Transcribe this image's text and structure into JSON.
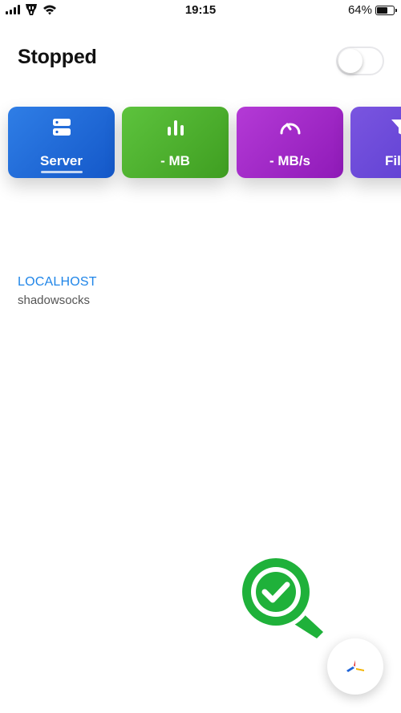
{
  "status_bar": {
    "time": "19:15",
    "battery_percent_label": "64%",
    "battery_level": 0.64,
    "carrier_icon": "transformers-logo-icon",
    "wifi_icon": "wifi-icon"
  },
  "header": {
    "title": "Stopped",
    "vpn_toggle": {
      "on": false
    }
  },
  "cards": [
    {
      "id": "server",
      "label": "Server",
      "icon": "server-icon",
      "selected": true,
      "color": "#1f6ad8"
    },
    {
      "id": "data",
      "label": "- MB",
      "icon": "bar-chart-icon",
      "selected": false,
      "color": "#4fb32d"
    },
    {
      "id": "speed",
      "label": "- MB/s",
      "icon": "speedometer-icon",
      "selected": false,
      "color": "#a12bc9"
    },
    {
      "id": "filter",
      "label": "Fil",
      "icon": "filter-icon",
      "selected": false,
      "color": "#6b48d8"
    }
  ],
  "server": {
    "name": "LOCALHOST",
    "type": "shadowsocks",
    "accent": "#1f85e8"
  },
  "badge": {
    "icon": "verified-check-icon",
    "color": "#1fb13a"
  },
  "fab": {
    "icon": "app-logo-icon"
  }
}
